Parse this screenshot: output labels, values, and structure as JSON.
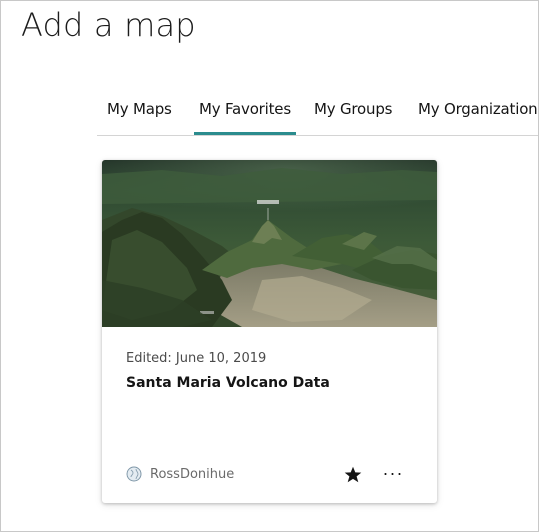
{
  "page": {
    "title": "Add a map"
  },
  "tabs": [
    {
      "label": "My Maps",
      "active": false
    },
    {
      "label": "My Favorites",
      "active": true
    },
    {
      "label": "My Groups",
      "active": false
    },
    {
      "label": "My Organization",
      "active": false
    }
  ],
  "card": {
    "edited": "Edited: June 10, 2019",
    "title": "Santa Maria Volcano Data",
    "owner": "RossDonihue",
    "favorited": true,
    "more_glyph": "···"
  },
  "colors": {
    "tab_accent": "#2b8c8e",
    "text": "#151515",
    "muted": "#6a6a6a"
  },
  "icons": {
    "owner": "globe-icon",
    "favorite": "star-filled-icon",
    "more": "more-horizontal-icon"
  }
}
